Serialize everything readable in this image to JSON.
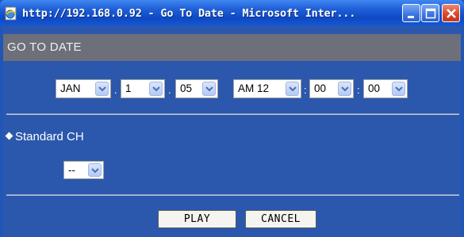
{
  "window": {
    "title": "http://192.168.0.92 - Go To Date - Microsoft Inter...",
    "controls": {
      "minimize_icon": "minimize-icon",
      "maximize_icon": "maximize-icon",
      "close_icon": "close-icon"
    }
  },
  "page": {
    "header": "GO TO DATE"
  },
  "date": {
    "month": "JAN",
    "day": "1",
    "year": "05",
    "hour": "AM 12",
    "minute": "00",
    "second": "00",
    "date_sep": ".",
    "time_sep": ":"
  },
  "channel": {
    "label": "Standard CH",
    "value": "--"
  },
  "buttons": {
    "play": "PLAY",
    "cancel": "CANCEL"
  },
  "colors": {
    "background": "#2b58ac",
    "header": "#6d6f7a",
    "titlebar": "#1f5fd8",
    "close": "#d5452a"
  }
}
